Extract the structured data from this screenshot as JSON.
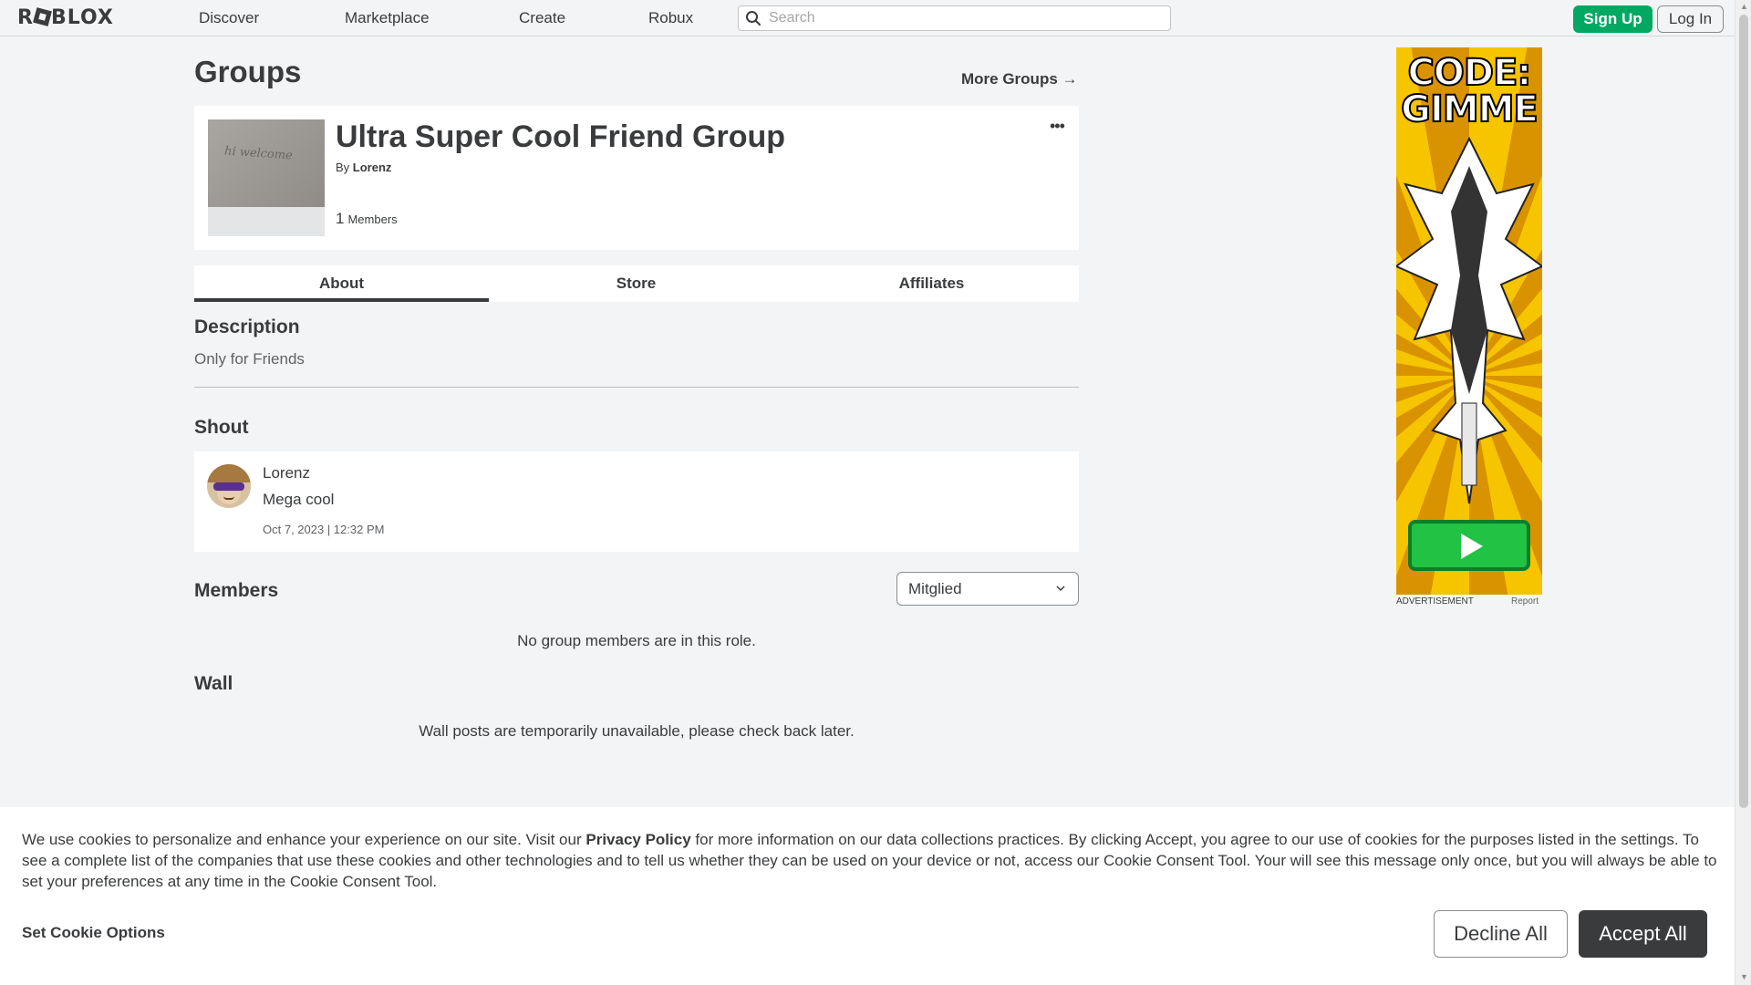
{
  "nav": {
    "logo": "ROBLOX",
    "links": [
      "Discover",
      "Marketplace",
      "Create",
      "Robux"
    ],
    "search_placeholder": "Search",
    "signup": "Sign Up",
    "login": "Log In"
  },
  "page": {
    "title": "Groups",
    "more_groups": "More Groups →"
  },
  "group": {
    "name": "Ultra Super Cool Friend Group",
    "by_label": "By",
    "owner": "Lorenz",
    "member_count": "1",
    "members_label": "Members",
    "menu": "•••"
  },
  "tabs": [
    "About",
    "Store",
    "Affiliates"
  ],
  "about": {
    "description_heading": "Description",
    "description": "Only for Friends",
    "shout_heading": "Shout",
    "shout": {
      "user": "Lorenz",
      "message": "Mega cool",
      "timestamp": "Oct 7, 2023 | 12:32 PM"
    },
    "members_heading": "Members",
    "role_select": "Mitglied",
    "members_empty": "No group members are in this role.",
    "wall_heading": "Wall",
    "wall_message": "Wall posts are temporarily unavailable, please check back later."
  },
  "ad": {
    "headline": "CODE: GIMME",
    "label": "ADVERTISEMENT",
    "report": "Report"
  },
  "cookie": {
    "text_1": "We use cookies to personalize and enhance your experience on our site. Visit our ",
    "privacy_link": "Privacy Policy",
    "text_2": " for more information on our data collections practices. By clicking Accept, you agree to our use of cookies for the purposes listed in the settings. To see a complete list of the companies that use these cookies and other technologies and to tell us whether they can be used on your device or not, access our Cookie Consent Tool. Your will see this message only once, but you will always be able to set your preferences at any time in the Cookie Consent Tool.",
    "set_options": "Set Cookie Options",
    "decline": "Decline All",
    "accept": "Accept All"
  },
  "colors": {
    "signup_green": "#00a862",
    "text_dark": "#393b3d",
    "background": "#f2f4f5"
  }
}
